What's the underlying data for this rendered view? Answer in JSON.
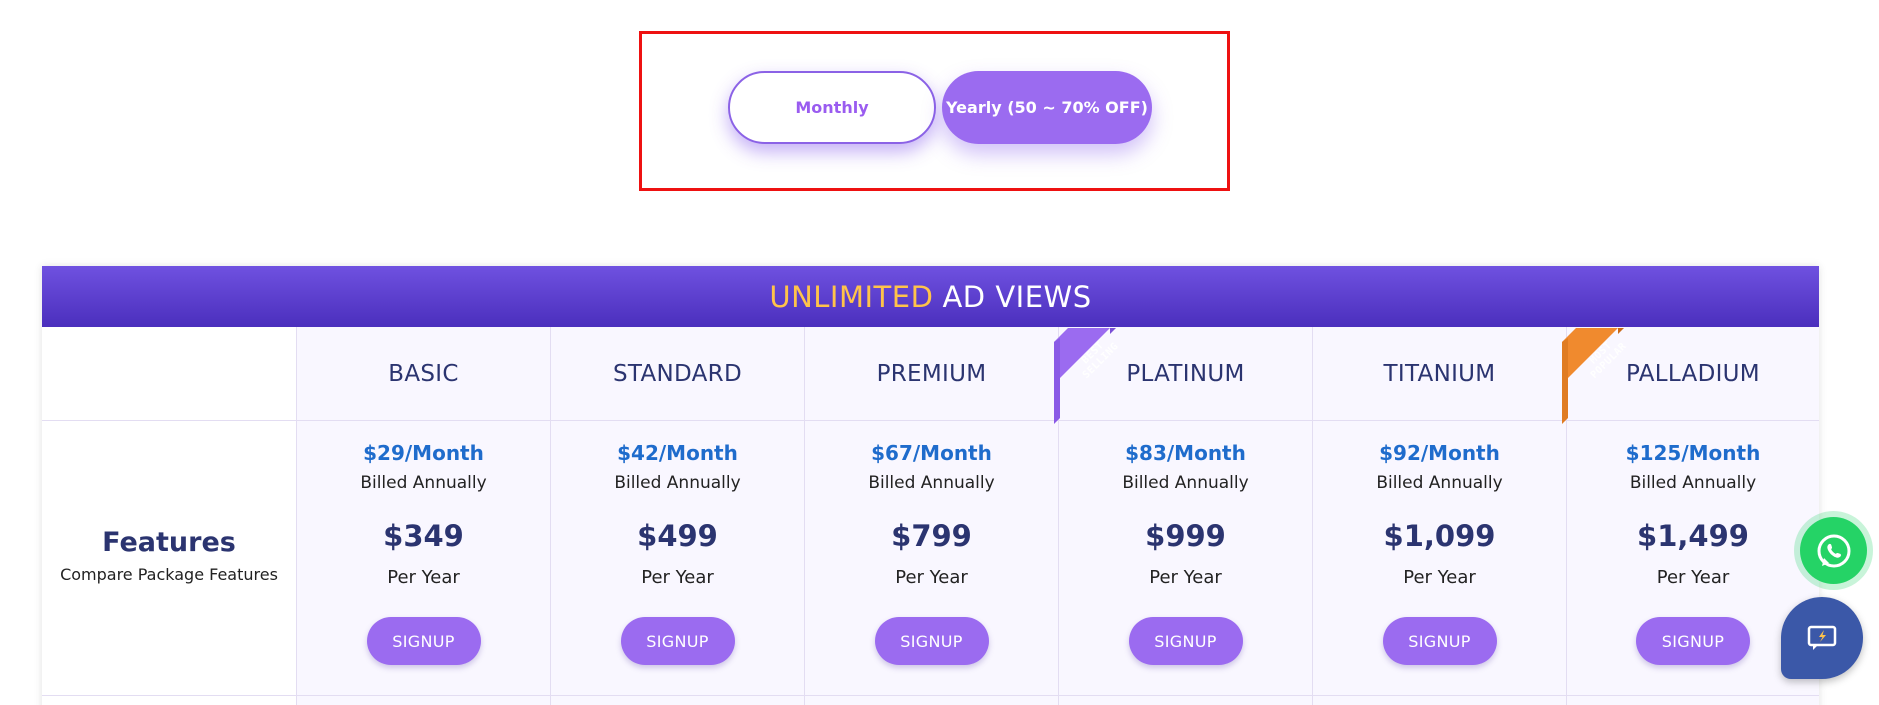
{
  "billing_toggle": {
    "monthly_label": "Monthly",
    "yearly_label": "Yearly (50 ~ 70% OFF)",
    "active": "yearly"
  },
  "banner": {
    "accent": "UNLIMITED",
    "rest": "AD VIEWS"
  },
  "features": {
    "title": "Features",
    "subtitle": "Compare Package Features"
  },
  "plans": [
    {
      "name": "BASIC",
      "monthly": "$29/Month",
      "billed": "Billed Annually",
      "yearly": "$349",
      "per": "Per Year",
      "signup": "SIGNUP"
    },
    {
      "name": "STANDARD",
      "monthly": "$42/Month",
      "billed": "Billed Annually",
      "yearly": "$499",
      "per": "Per Year",
      "signup": "SIGNUP"
    },
    {
      "name": "PREMIUM",
      "monthly": "$67/Month",
      "billed": "Billed Annually",
      "yearly": "$799",
      "per": "Per Year",
      "signup": "SIGNUP"
    },
    {
      "name": "PLATINUM",
      "monthly": "$83/Month",
      "billed": "Billed Annually",
      "yearly": "$999",
      "per": "Per Year",
      "signup": "SIGNUP"
    },
    {
      "name": "TITANIUM",
      "monthly": "$92/Month",
      "billed": "Billed Annually",
      "yearly": "$1,099",
      "per": "Per Year",
      "signup": "SIGNUP"
    },
    {
      "name": "PALLADIUM",
      "monthly": "$125/Month",
      "billed": "Billed Annually",
      "yearly": "$1,499",
      "per": "Per Year",
      "signup": "SIGNUP"
    }
  ],
  "ribbons": {
    "best_selling": {
      "line1": "BEST",
      "line2": "SELLING",
      "color": "#9b6bf0"
    },
    "most_popular": {
      "line1": "MOST",
      "line2": "POPULAR",
      "color": "#f08a2e"
    }
  },
  "colors": {
    "accent_purple": "#9b6bf0",
    "banner_purple": "#5a3ccf",
    "banner_accent": "#ffc34a",
    "price_blue": "#1f6ccc",
    "navy": "#2b3470",
    "whatsapp_green": "#25d366",
    "chat_blue": "#3b58a8"
  },
  "icons": {
    "whatsapp": "whatsapp-icon",
    "chat": "chat-icon"
  }
}
